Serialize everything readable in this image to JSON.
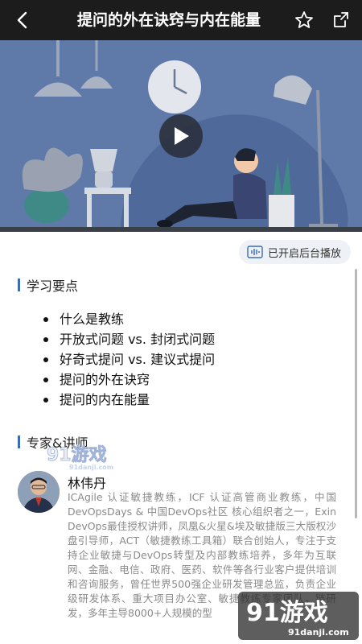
{
  "header": {
    "title": "提问的外在诀窍与内在能量",
    "back_icon": "chevron-left-icon",
    "favorite_icon": "star-outline-icon",
    "share_icon": "share-icon"
  },
  "video": {
    "play_icon": "play-icon",
    "bg_color": "#5e78a8"
  },
  "background_play": {
    "icon": "audio-wave-icon",
    "label": "已开启后台播放"
  },
  "learning_points": {
    "heading": "学习要点",
    "items": [
      "什么是教练",
      "开放式问题 vs. 封闭式问题",
      "好奇式提问 vs. 建议式提问",
      "提问的外在诀窍",
      "提问的内在能量"
    ]
  },
  "experts": {
    "heading": "专家&讲师",
    "name": "林伟丹",
    "bio": "ICAgile 认证敏捷教练，ICF 认证高管商业教练，中国 DevOpsDays & 中国DevOps社区 核心组织者之一，Exin DevOps最佳授权讲师，凤凰&火星&埃及敏捷版三大版权沙盘引导师，ACT（敏捷教练工具箱）联合创始人，专注于支持企业敏捷与DevOps转型及内部教练培养，多年为互联网、金融、电信、政府、医药、软件等各行业客户提供培训和咨询服务，曾任世界500强企业研发管理总监，负责企业级研发体系、重大项目办公室、敏捷教练专家团队，链研发，多年主导8000+人规模的型"
  },
  "watermarks": {
    "top_brand": "91游戏",
    "top_url": "91danji.com",
    "bottom_brand": "91游戏",
    "bottom_url": "91danji.com"
  },
  "colors": {
    "accent": "#3a6db5",
    "topbar": "#1c1c1c"
  }
}
